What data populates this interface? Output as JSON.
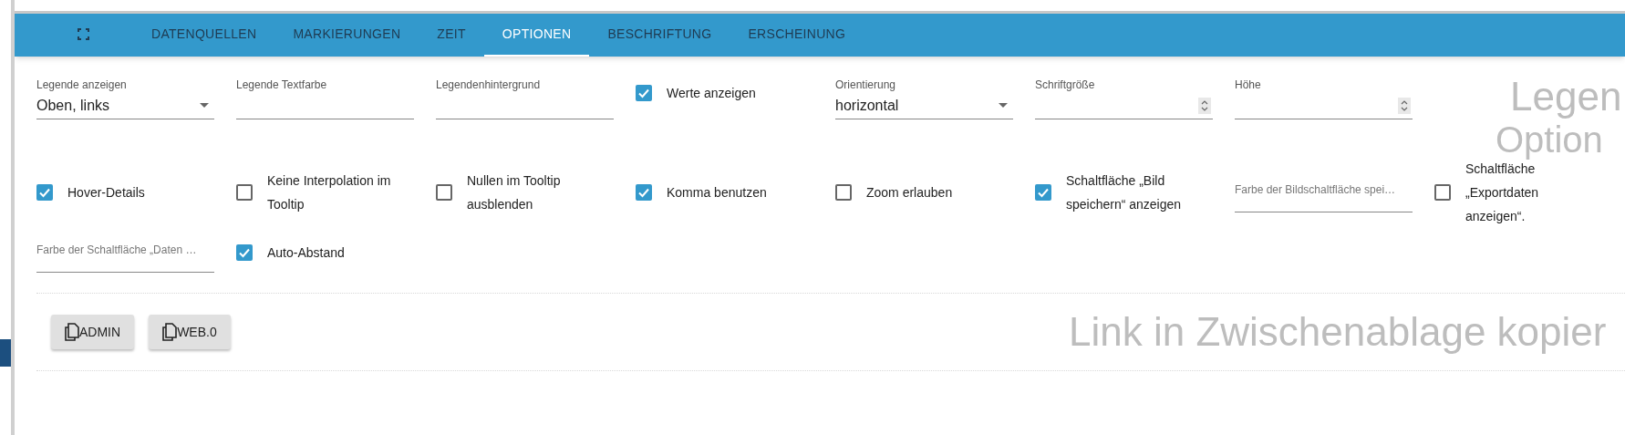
{
  "tabs": [
    {
      "kind": "icon",
      "selected": false
    },
    {
      "label": "DATENQUELLEN",
      "selected": false
    },
    {
      "label": "MARKIERUNGEN",
      "selected": false
    },
    {
      "label": "ZEIT",
      "selected": false
    },
    {
      "label": "OPTIONEN",
      "selected": true
    },
    {
      "label": "BESCHRIFTUNG",
      "selected": false
    },
    {
      "label": "ERSCHEINUNG",
      "selected": false
    }
  ],
  "sections": [
    {
      "title": "Legen",
      "items": [
        {
          "kind": "select",
          "label": "Legende anzeigen",
          "value": "Oben, links"
        },
        {
          "kind": "text",
          "label": "Legende Textfarbe"
        },
        {
          "kind": "text",
          "label": "Legendenhintergrund"
        },
        {
          "kind": "checkbox",
          "label": "Werte anzeigen",
          "checked": true
        },
        {
          "kind": "select",
          "label": "Orientierung",
          "value": "horizontal"
        },
        {
          "kind": "number",
          "label": "Schriftgröße"
        },
        {
          "kind": "number",
          "label": "Höhe"
        }
      ]
    },
    {
      "title": "Option",
      "items": [
        {
          "kind": "checkbox",
          "label": "Hover-Details",
          "checked": true
        },
        {
          "kind": "checkbox",
          "label": "Keine Interpolation im Tooltip",
          "checked": false
        },
        {
          "kind": "checkbox",
          "label": "Nullen im Tooltip ausblenden",
          "checked": false
        },
        {
          "kind": "checkbox",
          "label": "Komma benutzen",
          "checked": true
        },
        {
          "kind": "checkbox",
          "label": "Zoom erlauben",
          "checked": false
        },
        {
          "kind": "checkbox",
          "label": "Schaltfläche „Bild speichern“ anzeigen",
          "checked": true
        },
        {
          "kind": "color",
          "placeholder": "Farbe der Bildschaltfläche spei…"
        },
        {
          "kind": "checkbox",
          "label": "Schaltfläche „Exportdaten anzeigen“.",
          "checked": false
        },
        {
          "kind": "color",
          "placeholder": "Farbe der Schaltfläche „Daten …"
        },
        {
          "kind": "checkbox",
          "label": "Auto-Abstand",
          "checked": true
        }
      ]
    }
  ],
  "copy": {
    "title": "Link in Zwischenablage kopier",
    "buttons": [
      "ADMIN",
      "WEB.0"
    ]
  }
}
